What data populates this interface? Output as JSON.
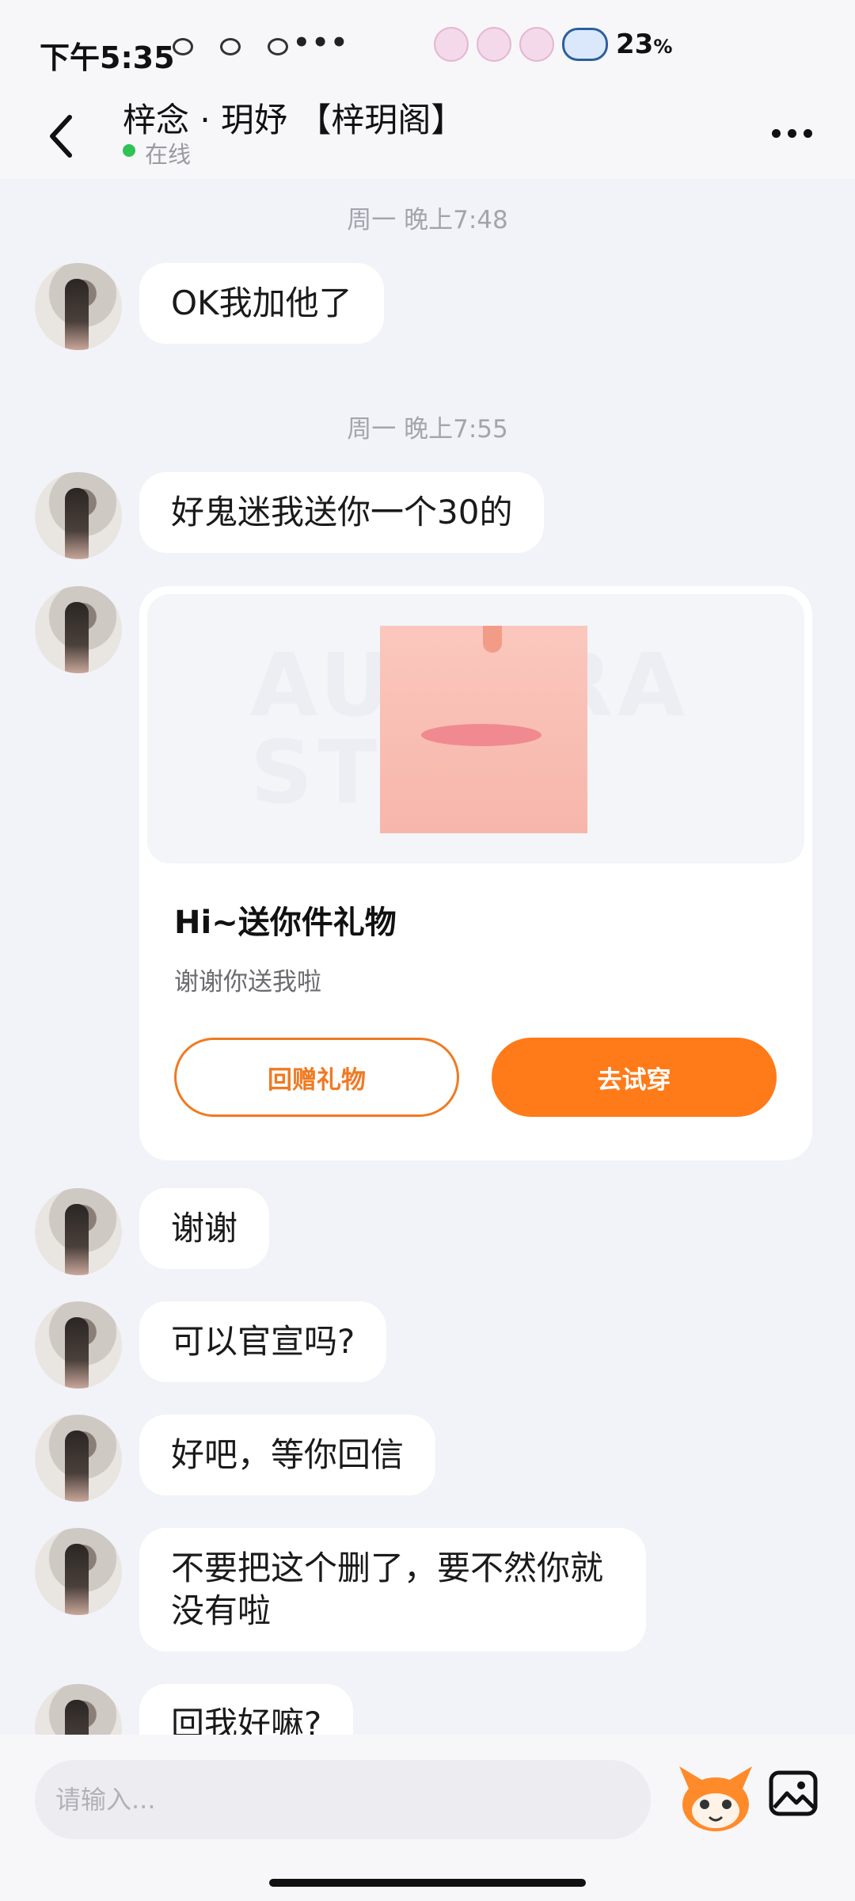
{
  "status_bar": {
    "time": "下午5:35",
    "dots": "•••",
    "battery": "23",
    "battery_unit": "%"
  },
  "header": {
    "contact_name": "梓念 · 玥妤 【梓玥阁】",
    "presence": "在线"
  },
  "messages": [
    {
      "type": "timestamp",
      "text": "周一 晚上7:48"
    },
    {
      "type": "text",
      "text": "OK我加他了"
    },
    {
      "type": "timestamp",
      "text": "周一 晚上7:55"
    },
    {
      "type": "text",
      "text": "好鬼迷我送你一个30的"
    },
    {
      "type": "gift_card",
      "watermark": "AURORA STORE",
      "title": "Hi~送你件礼物",
      "subtitle": "谢谢你送我啦",
      "return_button": "回赠礼物",
      "try_button": "去试穿"
    },
    {
      "type": "text",
      "text": "谢谢"
    },
    {
      "type": "text",
      "text": "可以官宣吗?"
    },
    {
      "type": "text",
      "text": "好吧，等你回信"
    },
    {
      "type": "text",
      "text": "不要把这个删了，要不然你就没有啦"
    },
    {
      "type": "text",
      "text": "回我好嘛?"
    }
  ],
  "input": {
    "placeholder": "请输入..."
  },
  "colors": {
    "accent": "#ff7a18",
    "online": "#2fc256",
    "background": "#f2f3f8"
  },
  "icons": [
    "back-arrow-icon",
    "more-icon",
    "emoji-mascot-icon",
    "image-icon"
  ]
}
